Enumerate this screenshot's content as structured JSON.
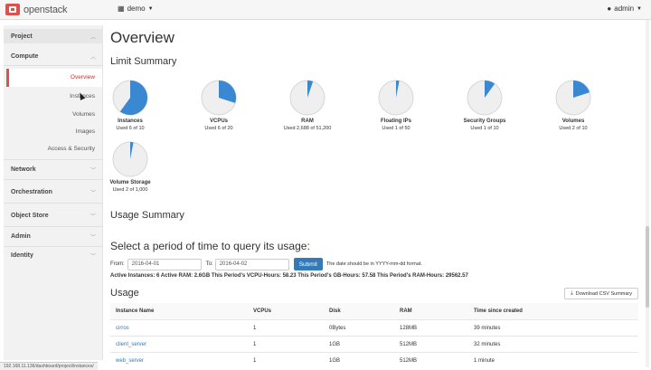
{
  "topbar": {
    "logo_text": "openstack",
    "project_label": "demo",
    "project_icon": "project-grid-icon",
    "user_label": "admin",
    "user_icon": "user-icon"
  },
  "sidebar": {
    "project": "Project",
    "compute": "Compute",
    "compute_items": [
      "Overview",
      "Instances",
      "Volumes",
      "Images",
      "Access & Security"
    ],
    "active_item": "Overview",
    "network": "Network",
    "orchestration": "Orchestration",
    "object_store": "Object Store",
    "admin": "Admin",
    "identity": "Identity"
  },
  "main": {
    "title": "Overview",
    "limit_summary": "Limit Summary",
    "usage_summary": "Usage Summary",
    "query_title": "Select a period of time to query its usage:",
    "from_label": "From:",
    "from_value": "2016-04-01",
    "to_label": "To:",
    "to_value": "2016-04-02",
    "submit": "Submit",
    "hint": "The date should be in YYYY-mm-dd format.",
    "stats": "Active Instances: 6 Active RAM: 2.6GB This Period's VCPU-Hours: 58.23 This Period's GB-Hours: 57.58 This Period's RAM-Hours: 29562.57",
    "usage_title": "Usage",
    "csv_button": "Download CSV Summary",
    "csv_icon": "download-icon"
  },
  "limits": [
    {
      "label": "Instances",
      "used_text": "Used 6 of 10",
      "used": 6,
      "total": 10
    },
    {
      "label": "VCPUs",
      "used_text": "Used 6 of 20",
      "used": 6,
      "total": 20
    },
    {
      "label": "RAM",
      "used_text": "Used 2,688 of 51,200",
      "used": 2688,
      "total": 51200
    },
    {
      "label": "Floating IPs",
      "used_text": "Used 1 of 50",
      "used": 1,
      "total": 50
    },
    {
      "label": "Security Groups",
      "used_text": "Used 1 of 10",
      "used": 1,
      "total": 10
    },
    {
      "label": "Volumes",
      "used_text": "Used 2 of 10",
      "used": 2,
      "total": 10
    },
    {
      "label": "Volume Storage",
      "used_text": "Used 2 of 1,000",
      "used": 2,
      "total": 1000
    }
  ],
  "table": {
    "headers": [
      "Instance Name",
      "VCPUs",
      "Disk",
      "RAM",
      "Time since created"
    ],
    "rows": [
      [
        "cirros",
        "1",
        "0Bytes",
        "128MB",
        "39 minutes"
      ],
      [
        "client_server",
        "1",
        "1GB",
        "512MB",
        "32 minutes"
      ],
      [
        "web_server",
        "1",
        "1GB",
        "512MB",
        "1 minute"
      ]
    ]
  },
  "status_url": "192.168.11.136/dashboard/project/instances/",
  "colors": {
    "pie_fill": "#3a87d2",
    "pie_bg": "#efefef",
    "accent": "#d9534f",
    "primary": "#337ab7"
  }
}
